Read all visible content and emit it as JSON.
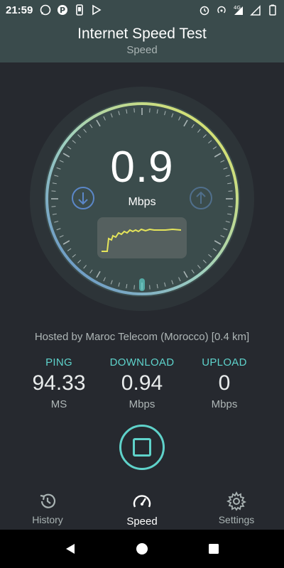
{
  "status_bar": {
    "time": "21:59",
    "left_icons": [
      "whatsapp-icon",
      "parking-p-icon",
      "phone-icon",
      "play-store-icon"
    ],
    "right_icons": [
      "alarm-icon",
      "hotspot-icon",
      "signal-4g-icon",
      "signal-bars-icon",
      "battery-icon"
    ],
    "network": "4G"
  },
  "app_bar": {
    "title": "Internet Speed Test",
    "subtitle": "Speed"
  },
  "gauge": {
    "speed_value": "0.9",
    "speed_unit": "Mbps",
    "download_icon": "arrow-down-circle-icon",
    "upload_icon": "arrow-up-circle-icon"
  },
  "hosted_by": "Hosted by Maroc Telecom (Morocco) [0.4 km]",
  "metrics": {
    "ping": {
      "label": "PING",
      "value": "94.33",
      "unit": "MS"
    },
    "download": {
      "label": "DOWNLOAD",
      "value": "0.94",
      "unit": "Mbps"
    },
    "upload": {
      "label": "UPLOAD",
      "value": "0",
      "unit": "Mbps"
    }
  },
  "bottom_nav": {
    "items": [
      {
        "label": "History",
        "icon": "history-icon",
        "active": false
      },
      {
        "label": "Speed",
        "icon": "speedometer-icon",
        "active": true
      },
      {
        "label": "Settings",
        "icon": "gear-icon",
        "active": false
      }
    ]
  },
  "colors": {
    "accent": "#5ed3cc",
    "background": "#26292f",
    "header": "#3a4b4c",
    "gauge_yellow": "#e3e35a",
    "gauge_blue": "#5b87c8"
  }
}
